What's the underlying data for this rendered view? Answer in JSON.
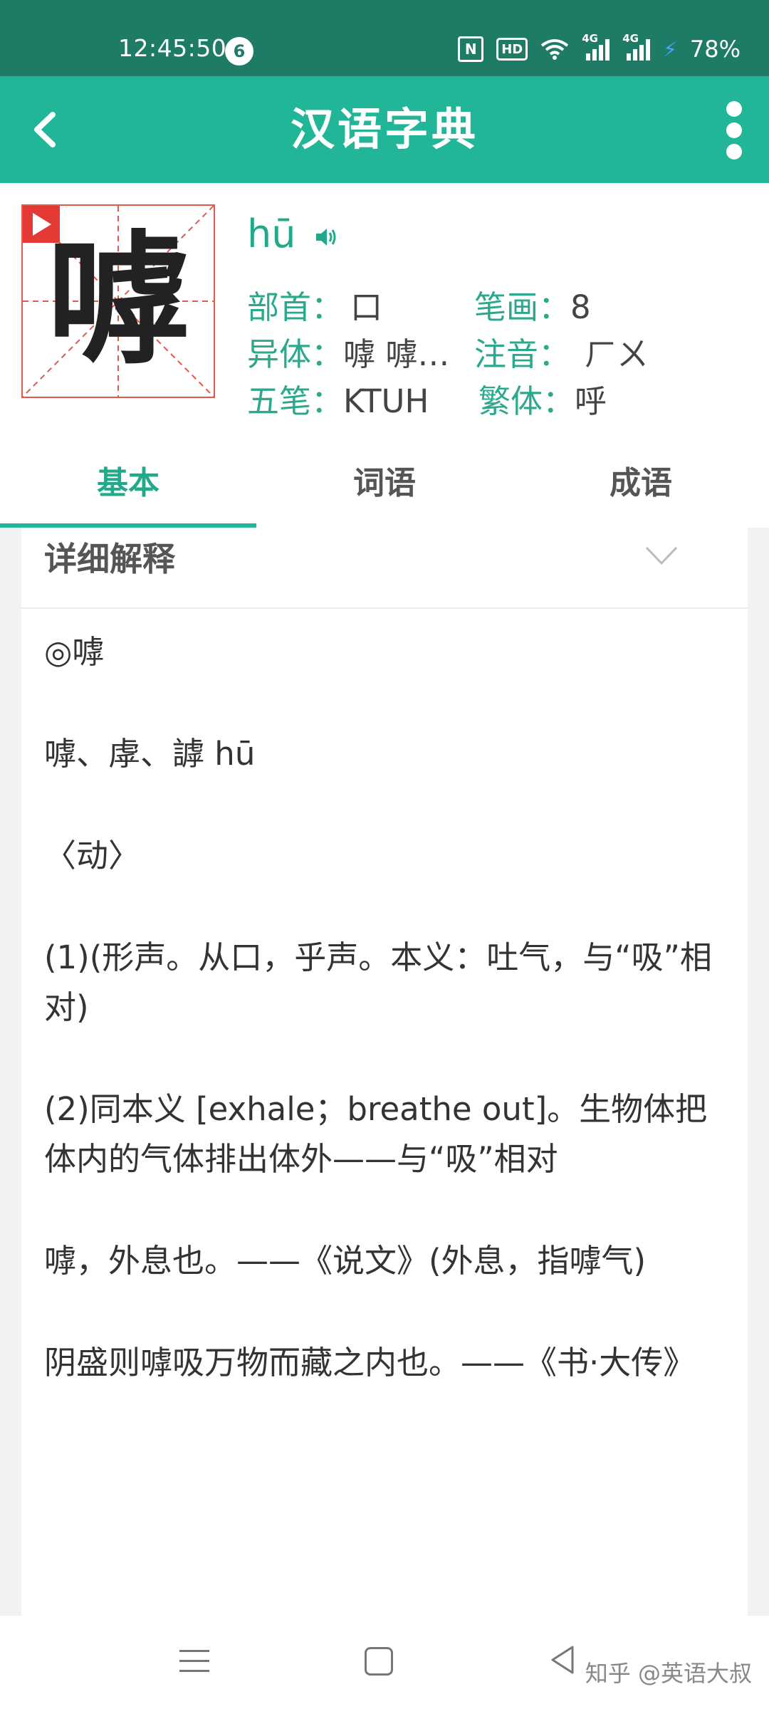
{
  "status_bar": {
    "time": "12:45:50",
    "notification_count": "6",
    "nfc": "N",
    "hd": "HD",
    "sim1": "4G",
    "sim2": "4G",
    "battery": "78%"
  },
  "app_bar": {
    "title": "汉语字典",
    "back_icon": "chevron-left-icon",
    "more_icon": "more-vertical-icon"
  },
  "character": {
    "glyph": "嘑",
    "pinyin": "hū",
    "radical_label": "部首：",
    "radical_value": "口",
    "strokes_label": "笔画：",
    "strokes_value": "8",
    "variant_label": "异体：",
    "variant_value": "嘑 嘑…",
    "zhuyin_label": "注音：",
    "zhuyin_value": "ㄏㄨ",
    "wubi_label": "五笔：",
    "wubi_value": "KTUH",
    "traditional_label": "繁体：",
    "traditional_value": "呼"
  },
  "tabs": [
    {
      "label": "基本",
      "active": true
    },
    {
      "label": "词语",
      "active": false
    },
    {
      "label": "成语",
      "active": false
    }
  ],
  "section": {
    "title": "详细解释",
    "definitions": [
      "◎嘑",
      "嘑、虖、謼 hū",
      "〈动〉",
      "(1)(形声。从口，乎声。本义：吐气，与“吸”相对)",
      "(2)同本义 [exhale；breathe out]。生物体把体内的气体排出体外——与“吸”相对",
      "嘑，外息也。——《说文》(外息，指嘑气)",
      "阴盛则嘑吸万物而藏之内也。——《书·大传》"
    ]
  },
  "bottom_nav": {
    "watermark": "知乎 @英语大叔"
  },
  "colors": {
    "status_bar": "#1e7b66",
    "app_bar": "#22b698",
    "accent": "#22a98b",
    "grid_red": "#e2594a"
  }
}
